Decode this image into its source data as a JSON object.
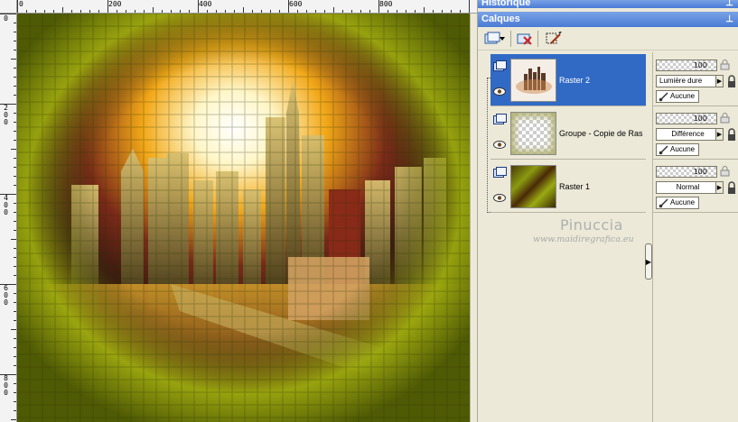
{
  "ruler": {
    "top_labels": [
      "0",
      "200",
      "400",
      "600",
      "800"
    ],
    "left_labels": [
      "0",
      "200",
      "400",
      "600",
      "800"
    ]
  },
  "panels": {
    "history_title": "Historique",
    "layers_title": "Calques",
    "pin_glyph": "⊥"
  },
  "toolbar": {
    "buttons": [
      "new-layer-icon",
      "dropdown-arrow-icon",
      "delete-layer-icon",
      "edit-selection-icon"
    ]
  },
  "layers": [
    {
      "name": "Raster 2",
      "opacity": "100",
      "blend": "Lumière dure",
      "mask": "Aucune",
      "selected": true,
      "thumb": "city"
    },
    {
      "name": "Groupe - Copie de Ras",
      "opacity": "100",
      "blend": "Différence",
      "mask": "Aucune",
      "selected": false,
      "thumb": "group"
    },
    {
      "name": "Raster 1",
      "opacity": "100",
      "blend": "Normal",
      "mask": "Aucune",
      "selected": false,
      "thumb": "olive"
    }
  ],
  "watermark": {
    "name": "Pinuccia",
    "url": "www.maidiregrafica.eu"
  },
  "colors": {
    "selection": "#316ac5",
    "title_bar": "#4a7bd5",
    "panel_bg": "#ece9d8",
    "canvas_frame": "#6b7a08"
  }
}
